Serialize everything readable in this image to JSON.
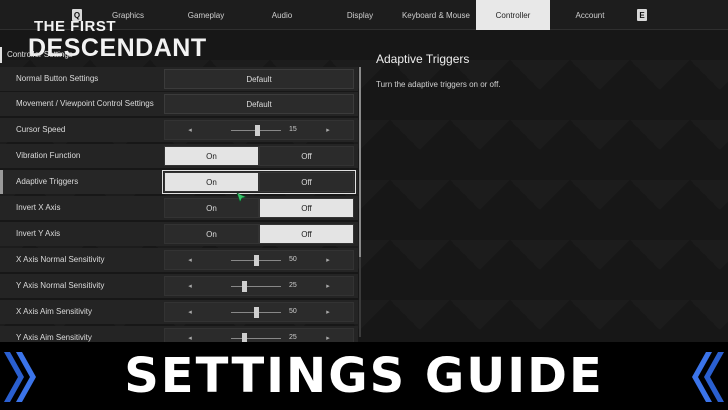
{
  "logo": {
    "line1": "THE FIRST",
    "line2": "DESCENDANT"
  },
  "topbar": {
    "left_key": "Q",
    "right_key": "E",
    "tabs": [
      {
        "label": "Graphics"
      },
      {
        "label": "Gameplay"
      },
      {
        "label": "Audio"
      },
      {
        "label": "Display"
      },
      {
        "label": "Keyboard & Mouse"
      },
      {
        "label": "Controller",
        "active": true
      },
      {
        "label": "Account"
      }
    ]
  },
  "section": {
    "title": "Controller Settings"
  },
  "settings": {
    "normal_button": {
      "label": "Normal Button Settings",
      "value": "Default"
    },
    "movement_viewpoint": {
      "label": "Movement / Viewpoint Control Settings",
      "value": "Default"
    },
    "cursor_speed": {
      "label": "Cursor Speed",
      "value": "15",
      "level_percent": 52
    },
    "vibration": {
      "label": "Vibration Function",
      "on": "On",
      "off": "Off",
      "selected": "On"
    },
    "adaptive_triggers": {
      "label": "Adaptive Triggers",
      "on": "On",
      "off": "Off",
      "selected": "On"
    },
    "invert_x": {
      "label": "Invert X Axis",
      "on": "On",
      "off": "Off",
      "selected": "Off"
    },
    "invert_y": {
      "label": "Invert Y Axis",
      "on": "On",
      "off": "Off",
      "selected": "Off"
    },
    "x_normal": {
      "label": "X Axis Normal Sensitivity",
      "value": "50",
      "level_percent": 50
    },
    "y_normal": {
      "label": "Y Axis Normal Sensitivity",
      "value": "25",
      "level_percent": 25
    },
    "x_aim": {
      "label": "X Axis Aim Sensitivity",
      "value": "50",
      "level_percent": 50
    },
    "y_aim": {
      "label": "Y Axis Aim Sensitivity",
      "value": "25",
      "level_percent": 25
    }
  },
  "description": {
    "title": "Adaptive Triggers",
    "text": "Turn the adaptive triggers on or off."
  },
  "banner": {
    "title": "SETTINGS GUIDE"
  },
  "colors": {
    "chevron": "#2a5fd0",
    "toggle_on": "#e4e4e4",
    "background": "#171717"
  },
  "icons": {
    "left_chevron": "double-chevron-left-icon",
    "right_chevron": "double-chevron-right-icon",
    "cursor": "mouse-cursor-icon"
  }
}
